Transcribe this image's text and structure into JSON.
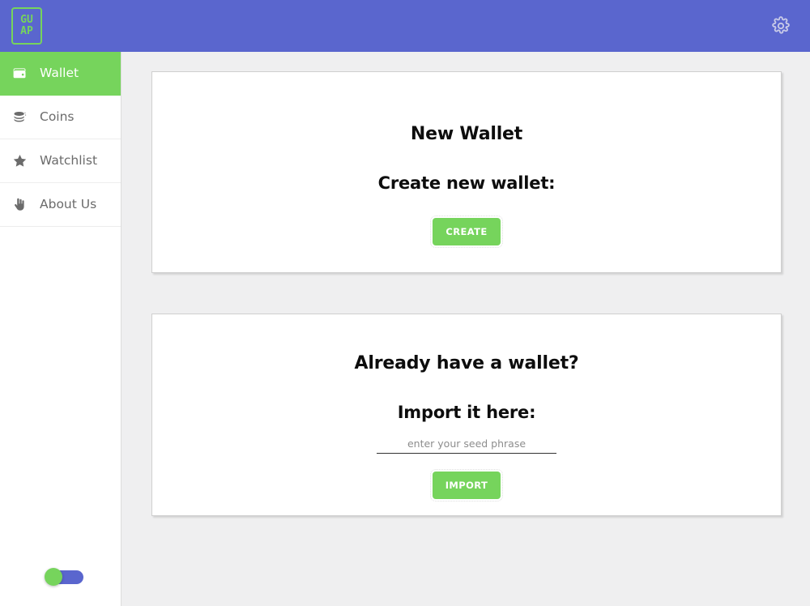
{
  "header": {
    "logo_line1": "GU",
    "logo_line2": "AP",
    "settings_icon": "gear-icon"
  },
  "sidebar": {
    "items": [
      {
        "label": "Wallet",
        "icon": "wallet-icon",
        "active": true
      },
      {
        "label": "Coins",
        "icon": "coins-icon",
        "active": false
      },
      {
        "label": "Watchlist",
        "icon": "star-icon",
        "active": false
      },
      {
        "label": "About Us",
        "icon": "hand-pointing-up-icon",
        "active": false
      }
    ],
    "theme_toggle": {
      "state": "off",
      "knob_color": "#76d45c",
      "track_color": "#5a66ce"
    }
  },
  "main": {
    "new_wallet_card": {
      "title": "New Wallet",
      "subtitle": "Create new wallet:",
      "button_label": "CREATE"
    },
    "import_wallet_card": {
      "title": "Already have a wallet?",
      "subtitle": "Import it here:",
      "seed_placeholder": "enter your seed phrase",
      "seed_value": "",
      "button_label": "IMPORT"
    }
  },
  "colors": {
    "header_blue": "#5a66ce",
    "accent_green": "#76d45c",
    "page_background": "#efeff0",
    "card_background": "#ffffff",
    "sidebar_text": "#6b6b6b",
    "heading_text": "#0d0d0d"
  }
}
